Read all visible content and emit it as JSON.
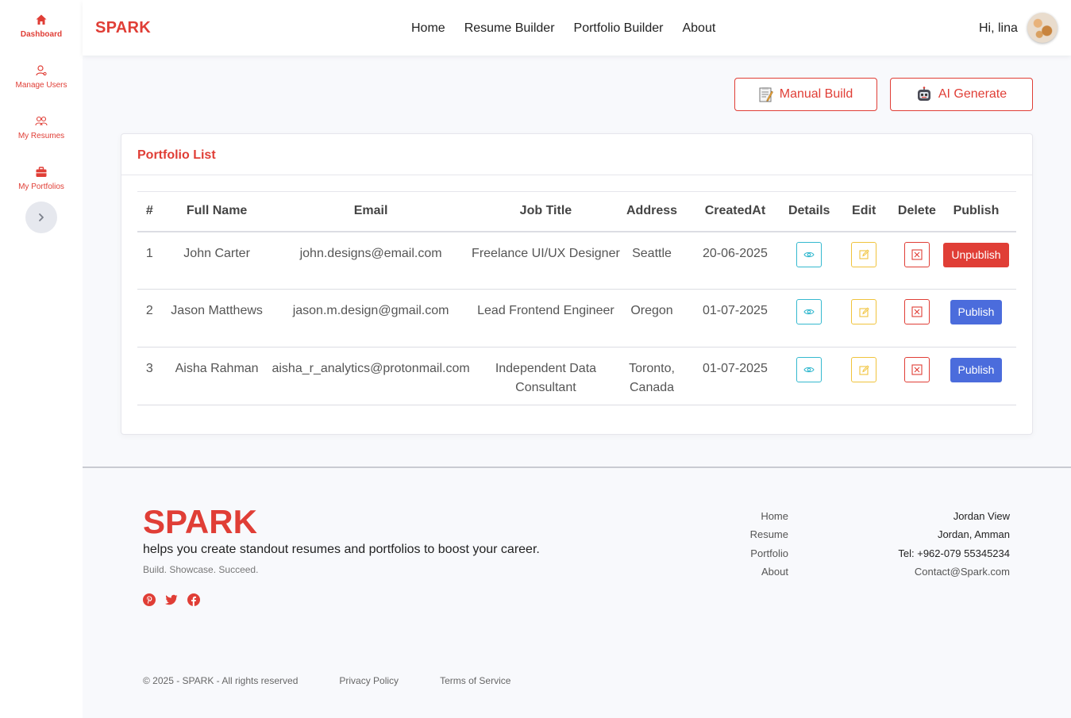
{
  "sidebar": {
    "items": [
      {
        "label": "Dashboard",
        "icon": "home-icon"
      },
      {
        "label": "Manage Users",
        "icon": "user-icon"
      },
      {
        "label": "My Resumes",
        "icon": "users-icon"
      },
      {
        "label": "My Portfolios",
        "icon": "briefcase-icon"
      }
    ],
    "toggle_icon": "chevron-right-icon"
  },
  "topbar": {
    "brand": "SPARK",
    "nav": [
      "Home",
      "Resume Builder",
      "Portfolio Builder",
      "About"
    ],
    "greeting": "Hi, lina"
  },
  "actions": {
    "manual_build": "Manual Build",
    "ai_generate": "AI Generate"
  },
  "portfolio": {
    "title": "Portfolio List",
    "columns": [
      "#",
      "Full Name",
      "Email",
      "Job Title",
      "Address",
      "CreatedAt",
      "Details",
      "Edit",
      "Delete",
      "Publish"
    ],
    "rows": [
      {
        "num": "1",
        "name": "John Carter",
        "email": "john.designs@email.com",
        "job": "Freelance UI/UX Designer",
        "address": "Seattle",
        "created": "20-06-2025",
        "publish": "Unpublish"
      },
      {
        "num": "2",
        "name": "Jason Matthews",
        "email": "jason.m.design@gmail.com",
        "job": "Lead Frontend Engineer",
        "address": "Oregon",
        "created": "01-07-2025",
        "publish": "Publish"
      },
      {
        "num": "3",
        "name": "Aisha Rahman",
        "email": "aisha_r_analytics@protonmail.com",
        "job": "Independent Data Consultant",
        "address": "Toronto, Canada",
        "created": "01-07-2025",
        "publish": "Publish"
      }
    ]
  },
  "footer": {
    "brand": "SPARK",
    "description": "helps you create standout resumes and portfolios to boost your career.",
    "tagline": "Build. Showcase. Succeed.",
    "links": [
      "Home",
      "Resume",
      "Portfolio",
      "About"
    ],
    "contact": [
      "Jordan View",
      "Jordan, Amman",
      "Tel: +962-079 55345234",
      "Contact@Spark.com"
    ],
    "copyright": "© 2025 - SPARK - All rights reserved",
    "privacy": "Privacy Policy",
    "terms": "Terms of Service"
  },
  "colors": {
    "accent": "#e03e36",
    "publish": "#4b6cdc",
    "view": "#35b9cf",
    "edit": "#f0c33c"
  }
}
